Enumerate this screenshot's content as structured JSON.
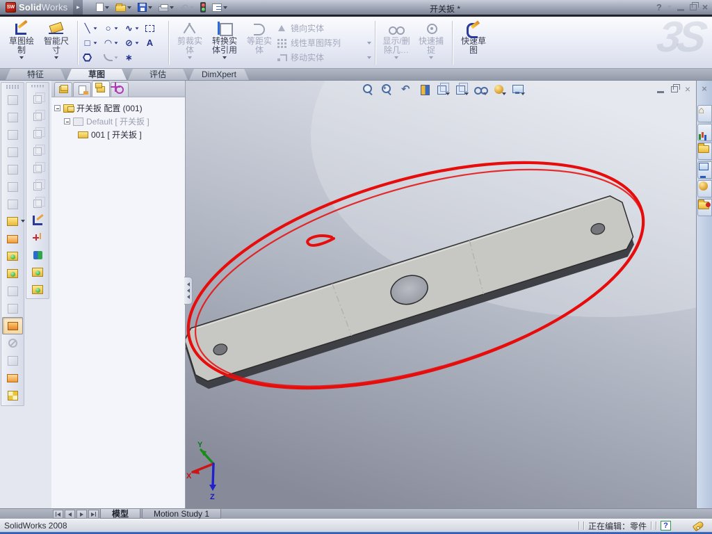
{
  "titlebar": {
    "app_name_bold": "Solid",
    "app_name_light": "Works",
    "logo_letters": "SW",
    "menu_arrow": "▸",
    "doc_title": "开关扳 *",
    "help": "?",
    "close": "×"
  },
  "icons": {
    "titlebar": [
      "new-document-icon",
      "open-icon",
      "save-icon",
      "print-icon",
      "undo-icon",
      "rebuild-traffic-light-icon",
      "options-list-icon"
    ],
    "hud": [
      "zoom-to-fit-icon",
      "zoom-to-area-icon",
      "previous-view-icon",
      "section-view-icon",
      "view-orientation-icon",
      "display-style-icon",
      "hide-show-items-icon",
      "appearances-icon",
      "scene-icon"
    ]
  },
  "ribbon": {
    "watermark": "3S",
    "big_buttons": [
      {
        "label": "草图绘制",
        "state": "enabled"
      },
      {
        "label": "智能尺寸",
        "state": "enabled"
      }
    ],
    "sketch_tools": [
      {
        "name": "line-tool",
        "glyph": "╲",
        "dd": true
      },
      {
        "name": "circle-tool",
        "glyph": "○",
        "dd": true
      },
      {
        "name": "spline-tool",
        "glyph": "∿",
        "dd": true
      },
      {
        "name": "box-select-tool",
        "glyph": "",
        "dd": false,
        "cls": "selbox"
      },
      {
        "name": "rectangle-tool",
        "glyph": "□",
        "dd": true
      },
      {
        "name": "arc-tool",
        "glyph": "◠",
        "dd": true
      },
      {
        "name": "ellipse-tool",
        "glyph": "⊘",
        "dd": true
      },
      {
        "name": "text-tool",
        "glyph": "A",
        "dd": false
      },
      {
        "name": "polygon-tool",
        "glyph": "",
        "dd": false,
        "cls": "hex"
      },
      {
        "name": "fillet-tool",
        "glyph": "",
        "dd": true,
        "cls": "fillet"
      },
      {
        "name": "point-tool",
        "glyph": "∗",
        "dd": false
      }
    ],
    "group3_big": [
      {
        "label": "剪裁实体",
        "state": "disabled"
      },
      {
        "label": "转换实体引用",
        "state": "enabled"
      },
      {
        "label": "等距实体",
        "state": "disabled"
      }
    ],
    "group3_rows": [
      {
        "label": "镜向实体",
        "dd": false
      },
      {
        "label": "线性草图阵列",
        "dd": true
      },
      {
        "label": "移动实体",
        "dd": true
      }
    ],
    "group4_big": [
      {
        "label": "显示/删除几…",
        "state": "disabled"
      },
      {
        "label": "快速捕捉",
        "state": "disabled"
      }
    ],
    "group5_big": [
      {
        "label": "快速草图",
        "state": "enabled"
      }
    ]
  },
  "mode_tabs": [
    {
      "name": "tab-features",
      "label": "特征",
      "active": false
    },
    {
      "name": "tab-sketch",
      "label": "草图",
      "active": true
    },
    {
      "name": "tab-evaluate",
      "label": "评估",
      "active": false
    },
    {
      "name": "tab-dimxpert",
      "label": "DimXpert",
      "active": false
    }
  ],
  "feature_tree": {
    "root": "开关扳 配置 (001)",
    "child": "Default [ 开关扳 ]",
    "grandchild": "001 [ 开关扳 ]"
  },
  "left_toolbar_1": [
    {
      "name": "insert-bends-tool",
      "cls": "k-ghost"
    },
    {
      "name": "base-flange-tool",
      "cls": "k-ghost"
    },
    {
      "name": "edge-flange-tool",
      "cls": "k-ghost"
    },
    {
      "name": "miter-flange-tool",
      "cls": "k-ghost"
    },
    {
      "name": "hem-tool",
      "cls": "k-ghost"
    },
    {
      "name": "jog-tool",
      "cls": "k-ghost"
    },
    {
      "name": "sketched-bend-tool",
      "cls": "k-ghost"
    },
    {
      "name": "closed-corner-tool",
      "cls": "k-gold k-dd"
    },
    {
      "name": "forming-tool",
      "cls": "k-orange"
    },
    {
      "name": "extruded-cut-tool",
      "cls": "k-goldgreen"
    },
    {
      "name": "simple-hole-tool",
      "cls": "k-goldgreen"
    },
    {
      "name": "unfold-tool",
      "cls": "k-ghost"
    },
    {
      "name": "fold-tool",
      "cls": "k-ghost"
    },
    {
      "name": "flatten-tool",
      "cls": "k-pressed"
    },
    {
      "name": "no-bends-tool",
      "cls": "k-grayround"
    },
    {
      "name": "rip-tool",
      "cls": "k-ghost"
    },
    {
      "name": "vent-tool",
      "cls": "k-orange"
    },
    {
      "name": "sheet-metal-library-tool",
      "cls": "k-checker"
    }
  ],
  "left_toolbar_2": [
    {
      "name": "front-view-tool",
      "cls": "k-cube"
    },
    {
      "name": "back-view-tool",
      "cls": "k-cube"
    },
    {
      "name": "left-view-tool",
      "cls": "k-cube"
    },
    {
      "name": "right-view-tool",
      "cls": "k-cube"
    },
    {
      "name": "top-view-tool",
      "cls": "k-cube"
    },
    {
      "name": "bottom-view-tool",
      "cls": "k-cube"
    },
    {
      "name": "isometric-view-tool",
      "cls": "k-cube"
    },
    {
      "name": "sketch-toggle-tool",
      "cls": "k-sketch"
    },
    {
      "name": "3d-sketch-tool",
      "cls": "k-sketchplus"
    },
    {
      "name": "move-copy-tool",
      "cls": "k-movearrows"
    },
    {
      "name": "convert-entities-side-tool",
      "cls": "k-goldgreen"
    },
    {
      "name": "offset-entities-side-tool",
      "cls": "k-goldgreen"
    }
  ],
  "task_pane": {
    "close": "×",
    "tabs": [
      {
        "name": "home-tab",
        "cls": "t-home"
      },
      {
        "name": "solidworks-resources-tab",
        "cls": "t-resources"
      },
      {
        "name": "design-library-tab",
        "cls": "t-folder"
      },
      {
        "name": "file-explorer-tab",
        "cls": "t-explorer"
      },
      {
        "name": "view-palette-tab",
        "cls": "t-sphere"
      },
      {
        "name": "appearances-scenes-tab",
        "cls": "t-foldersearch"
      }
    ]
  },
  "viewport": {
    "triad": {
      "x": "X",
      "y": "Y",
      "z": "Z"
    }
  },
  "bottom_tabs": {
    "model": "模型",
    "motion": "Motion Study 1"
  },
  "status": {
    "left": "SolidWorks 2008",
    "editing": "正在编辑：零件",
    "help_badge": "?"
  }
}
